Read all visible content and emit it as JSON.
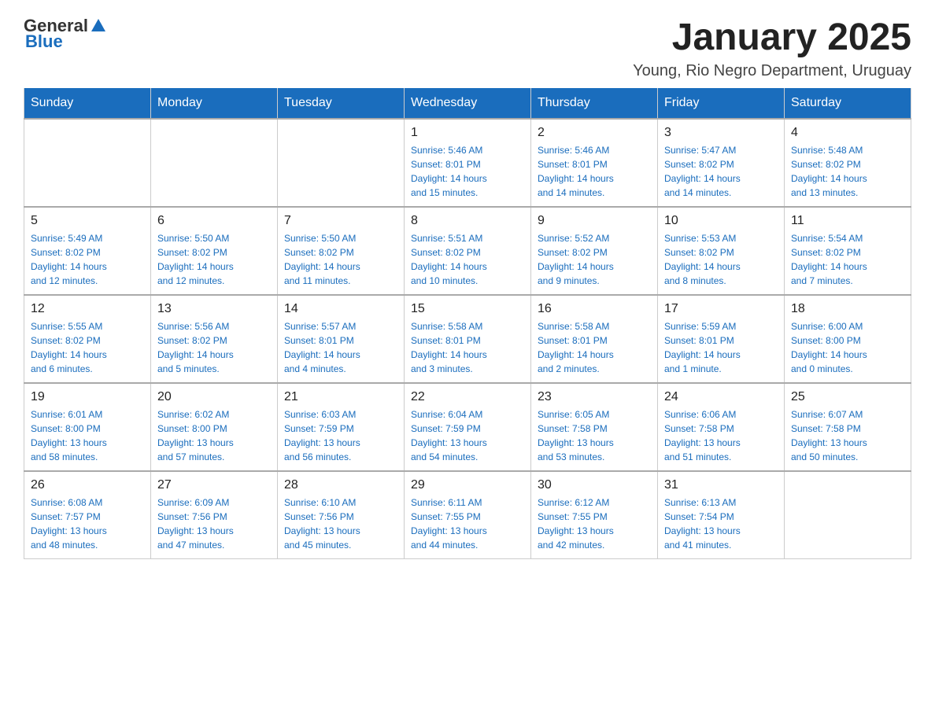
{
  "logo": {
    "text_general": "General",
    "text_blue": "Blue"
  },
  "header": {
    "title": "January 2025",
    "subtitle": "Young, Rio Negro Department, Uruguay"
  },
  "days_of_week": [
    "Sunday",
    "Monday",
    "Tuesday",
    "Wednesday",
    "Thursday",
    "Friday",
    "Saturday"
  ],
  "weeks": [
    [
      {
        "day": "",
        "info": ""
      },
      {
        "day": "",
        "info": ""
      },
      {
        "day": "",
        "info": ""
      },
      {
        "day": "1",
        "info": "Sunrise: 5:46 AM\nSunset: 8:01 PM\nDaylight: 14 hours\nand 15 minutes."
      },
      {
        "day": "2",
        "info": "Sunrise: 5:46 AM\nSunset: 8:01 PM\nDaylight: 14 hours\nand 14 minutes."
      },
      {
        "day": "3",
        "info": "Sunrise: 5:47 AM\nSunset: 8:02 PM\nDaylight: 14 hours\nand 14 minutes."
      },
      {
        "day": "4",
        "info": "Sunrise: 5:48 AM\nSunset: 8:02 PM\nDaylight: 14 hours\nand 13 minutes."
      }
    ],
    [
      {
        "day": "5",
        "info": "Sunrise: 5:49 AM\nSunset: 8:02 PM\nDaylight: 14 hours\nand 12 minutes."
      },
      {
        "day": "6",
        "info": "Sunrise: 5:50 AM\nSunset: 8:02 PM\nDaylight: 14 hours\nand 12 minutes."
      },
      {
        "day": "7",
        "info": "Sunrise: 5:50 AM\nSunset: 8:02 PM\nDaylight: 14 hours\nand 11 minutes."
      },
      {
        "day": "8",
        "info": "Sunrise: 5:51 AM\nSunset: 8:02 PM\nDaylight: 14 hours\nand 10 minutes."
      },
      {
        "day": "9",
        "info": "Sunrise: 5:52 AM\nSunset: 8:02 PM\nDaylight: 14 hours\nand 9 minutes."
      },
      {
        "day": "10",
        "info": "Sunrise: 5:53 AM\nSunset: 8:02 PM\nDaylight: 14 hours\nand 8 minutes."
      },
      {
        "day": "11",
        "info": "Sunrise: 5:54 AM\nSunset: 8:02 PM\nDaylight: 14 hours\nand 7 minutes."
      }
    ],
    [
      {
        "day": "12",
        "info": "Sunrise: 5:55 AM\nSunset: 8:02 PM\nDaylight: 14 hours\nand 6 minutes."
      },
      {
        "day": "13",
        "info": "Sunrise: 5:56 AM\nSunset: 8:02 PM\nDaylight: 14 hours\nand 5 minutes."
      },
      {
        "day": "14",
        "info": "Sunrise: 5:57 AM\nSunset: 8:01 PM\nDaylight: 14 hours\nand 4 minutes."
      },
      {
        "day": "15",
        "info": "Sunrise: 5:58 AM\nSunset: 8:01 PM\nDaylight: 14 hours\nand 3 minutes."
      },
      {
        "day": "16",
        "info": "Sunrise: 5:58 AM\nSunset: 8:01 PM\nDaylight: 14 hours\nand 2 minutes."
      },
      {
        "day": "17",
        "info": "Sunrise: 5:59 AM\nSunset: 8:01 PM\nDaylight: 14 hours\nand 1 minute."
      },
      {
        "day": "18",
        "info": "Sunrise: 6:00 AM\nSunset: 8:00 PM\nDaylight: 14 hours\nand 0 minutes."
      }
    ],
    [
      {
        "day": "19",
        "info": "Sunrise: 6:01 AM\nSunset: 8:00 PM\nDaylight: 13 hours\nand 58 minutes."
      },
      {
        "day": "20",
        "info": "Sunrise: 6:02 AM\nSunset: 8:00 PM\nDaylight: 13 hours\nand 57 minutes."
      },
      {
        "day": "21",
        "info": "Sunrise: 6:03 AM\nSunset: 7:59 PM\nDaylight: 13 hours\nand 56 minutes."
      },
      {
        "day": "22",
        "info": "Sunrise: 6:04 AM\nSunset: 7:59 PM\nDaylight: 13 hours\nand 54 minutes."
      },
      {
        "day": "23",
        "info": "Sunrise: 6:05 AM\nSunset: 7:58 PM\nDaylight: 13 hours\nand 53 minutes."
      },
      {
        "day": "24",
        "info": "Sunrise: 6:06 AM\nSunset: 7:58 PM\nDaylight: 13 hours\nand 51 minutes."
      },
      {
        "day": "25",
        "info": "Sunrise: 6:07 AM\nSunset: 7:58 PM\nDaylight: 13 hours\nand 50 minutes."
      }
    ],
    [
      {
        "day": "26",
        "info": "Sunrise: 6:08 AM\nSunset: 7:57 PM\nDaylight: 13 hours\nand 48 minutes."
      },
      {
        "day": "27",
        "info": "Sunrise: 6:09 AM\nSunset: 7:56 PM\nDaylight: 13 hours\nand 47 minutes."
      },
      {
        "day": "28",
        "info": "Sunrise: 6:10 AM\nSunset: 7:56 PM\nDaylight: 13 hours\nand 45 minutes."
      },
      {
        "day": "29",
        "info": "Sunrise: 6:11 AM\nSunset: 7:55 PM\nDaylight: 13 hours\nand 44 minutes."
      },
      {
        "day": "30",
        "info": "Sunrise: 6:12 AM\nSunset: 7:55 PM\nDaylight: 13 hours\nand 42 minutes."
      },
      {
        "day": "31",
        "info": "Sunrise: 6:13 AM\nSunset: 7:54 PM\nDaylight: 13 hours\nand 41 minutes."
      },
      {
        "day": "",
        "info": ""
      }
    ]
  ]
}
